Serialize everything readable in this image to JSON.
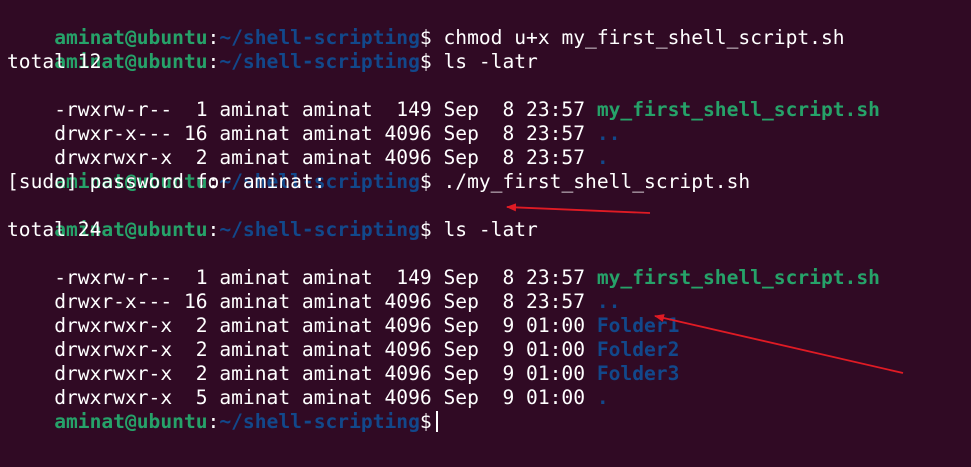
{
  "prompt": {
    "user": "aminat@ubuntu",
    "sep": ":",
    "path": "~/shell-scripting",
    "symbol": "$"
  },
  "lines": {
    "l1_cmd": " chmod u+x my_first_shell_script.sh",
    "l2_cmd": " ls -latr",
    "l3_text": "total 12",
    "l4_meta": "-rwxrw-r--  1 aminat aminat  149 Sep  8 23:57 ",
    "l4_name": "my_first_shell_script.sh",
    "l5_meta": "drwxr-x--- 16 aminat aminat 4096 Sep  8 23:57 ",
    "l5_name": "..",
    "l6_meta": "drwxrwxr-x  2 aminat aminat 4096 Sep  8 23:57 ",
    "l6_name": ".",
    "l7_cmd": " ./my_first_shell_script.sh",
    "l8_text": "[sudo] password for aminat:",
    "l9_cmd": " ls -latr",
    "l10_text": "total 24",
    "l11_meta": "-rwxrw-r--  1 aminat aminat  149 Sep  8 23:57 ",
    "l11_name": "my_first_shell_script.sh",
    "l12_meta": "drwxr-x--- 16 aminat aminat 4096 Sep  8 23:57 ",
    "l12_name": "..",
    "l13_meta": "drwxrwxr-x  2 aminat aminat 4096 Sep  9 01:00 ",
    "l13_name": "Folder1",
    "l14_meta": "drwxrwxr-x  2 aminat aminat 4096 Sep  9 01:00 ",
    "l14_name": "Folder2",
    "l15_meta": "drwxrwxr-x  2 aminat aminat 4096 Sep  9 01:00 ",
    "l15_name": "Folder3",
    "l16_meta": "drwxrwxr-x  5 aminat aminat 4096 Sep  9 01:00 ",
    "l16_name": "."
  },
  "colors": {
    "background": "#300a24",
    "prompt_user": "#26a269",
    "prompt_path": "#12488b",
    "annotation_arrow": "#e01b24"
  }
}
